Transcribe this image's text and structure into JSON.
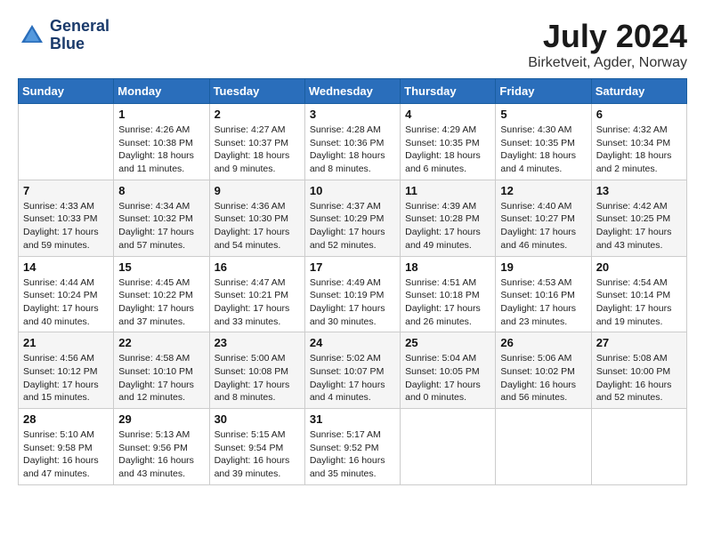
{
  "header": {
    "logo_line1": "General",
    "logo_line2": "Blue",
    "month_year": "July 2024",
    "location": "Birketveit, Agder, Norway"
  },
  "days_of_week": [
    "Sunday",
    "Monday",
    "Tuesday",
    "Wednesday",
    "Thursday",
    "Friday",
    "Saturday"
  ],
  "weeks": [
    [
      {
        "day": "",
        "info": ""
      },
      {
        "day": "1",
        "info": "Sunrise: 4:26 AM\nSunset: 10:38 PM\nDaylight: 18 hours\nand 11 minutes."
      },
      {
        "day": "2",
        "info": "Sunrise: 4:27 AM\nSunset: 10:37 PM\nDaylight: 18 hours\nand 9 minutes."
      },
      {
        "day": "3",
        "info": "Sunrise: 4:28 AM\nSunset: 10:36 PM\nDaylight: 18 hours\nand 8 minutes."
      },
      {
        "day": "4",
        "info": "Sunrise: 4:29 AM\nSunset: 10:35 PM\nDaylight: 18 hours\nand 6 minutes."
      },
      {
        "day": "5",
        "info": "Sunrise: 4:30 AM\nSunset: 10:35 PM\nDaylight: 18 hours\nand 4 minutes."
      },
      {
        "day": "6",
        "info": "Sunrise: 4:32 AM\nSunset: 10:34 PM\nDaylight: 18 hours\nand 2 minutes."
      }
    ],
    [
      {
        "day": "7",
        "info": "Sunrise: 4:33 AM\nSunset: 10:33 PM\nDaylight: 17 hours\nand 59 minutes."
      },
      {
        "day": "8",
        "info": "Sunrise: 4:34 AM\nSunset: 10:32 PM\nDaylight: 17 hours\nand 57 minutes."
      },
      {
        "day": "9",
        "info": "Sunrise: 4:36 AM\nSunset: 10:30 PM\nDaylight: 17 hours\nand 54 minutes."
      },
      {
        "day": "10",
        "info": "Sunrise: 4:37 AM\nSunset: 10:29 PM\nDaylight: 17 hours\nand 52 minutes."
      },
      {
        "day": "11",
        "info": "Sunrise: 4:39 AM\nSunset: 10:28 PM\nDaylight: 17 hours\nand 49 minutes."
      },
      {
        "day": "12",
        "info": "Sunrise: 4:40 AM\nSunset: 10:27 PM\nDaylight: 17 hours\nand 46 minutes."
      },
      {
        "day": "13",
        "info": "Sunrise: 4:42 AM\nSunset: 10:25 PM\nDaylight: 17 hours\nand 43 minutes."
      }
    ],
    [
      {
        "day": "14",
        "info": "Sunrise: 4:44 AM\nSunset: 10:24 PM\nDaylight: 17 hours\nand 40 minutes."
      },
      {
        "day": "15",
        "info": "Sunrise: 4:45 AM\nSunset: 10:22 PM\nDaylight: 17 hours\nand 37 minutes."
      },
      {
        "day": "16",
        "info": "Sunrise: 4:47 AM\nSunset: 10:21 PM\nDaylight: 17 hours\nand 33 minutes."
      },
      {
        "day": "17",
        "info": "Sunrise: 4:49 AM\nSunset: 10:19 PM\nDaylight: 17 hours\nand 30 minutes."
      },
      {
        "day": "18",
        "info": "Sunrise: 4:51 AM\nSunset: 10:18 PM\nDaylight: 17 hours\nand 26 minutes."
      },
      {
        "day": "19",
        "info": "Sunrise: 4:53 AM\nSunset: 10:16 PM\nDaylight: 17 hours\nand 23 minutes."
      },
      {
        "day": "20",
        "info": "Sunrise: 4:54 AM\nSunset: 10:14 PM\nDaylight: 17 hours\nand 19 minutes."
      }
    ],
    [
      {
        "day": "21",
        "info": "Sunrise: 4:56 AM\nSunset: 10:12 PM\nDaylight: 17 hours\nand 15 minutes."
      },
      {
        "day": "22",
        "info": "Sunrise: 4:58 AM\nSunset: 10:10 PM\nDaylight: 17 hours\nand 12 minutes."
      },
      {
        "day": "23",
        "info": "Sunrise: 5:00 AM\nSunset: 10:08 PM\nDaylight: 17 hours\nand 8 minutes."
      },
      {
        "day": "24",
        "info": "Sunrise: 5:02 AM\nSunset: 10:07 PM\nDaylight: 17 hours\nand 4 minutes."
      },
      {
        "day": "25",
        "info": "Sunrise: 5:04 AM\nSunset: 10:05 PM\nDaylight: 17 hours\nand 0 minutes."
      },
      {
        "day": "26",
        "info": "Sunrise: 5:06 AM\nSunset: 10:02 PM\nDaylight: 16 hours\nand 56 minutes."
      },
      {
        "day": "27",
        "info": "Sunrise: 5:08 AM\nSunset: 10:00 PM\nDaylight: 16 hours\nand 52 minutes."
      }
    ],
    [
      {
        "day": "28",
        "info": "Sunrise: 5:10 AM\nSunset: 9:58 PM\nDaylight: 16 hours\nand 47 minutes."
      },
      {
        "day": "29",
        "info": "Sunrise: 5:13 AM\nSunset: 9:56 PM\nDaylight: 16 hours\nand 43 minutes."
      },
      {
        "day": "30",
        "info": "Sunrise: 5:15 AM\nSunset: 9:54 PM\nDaylight: 16 hours\nand 39 minutes."
      },
      {
        "day": "31",
        "info": "Sunrise: 5:17 AM\nSunset: 9:52 PM\nDaylight: 16 hours\nand 35 minutes."
      },
      {
        "day": "",
        "info": ""
      },
      {
        "day": "",
        "info": ""
      },
      {
        "day": "",
        "info": ""
      }
    ]
  ]
}
